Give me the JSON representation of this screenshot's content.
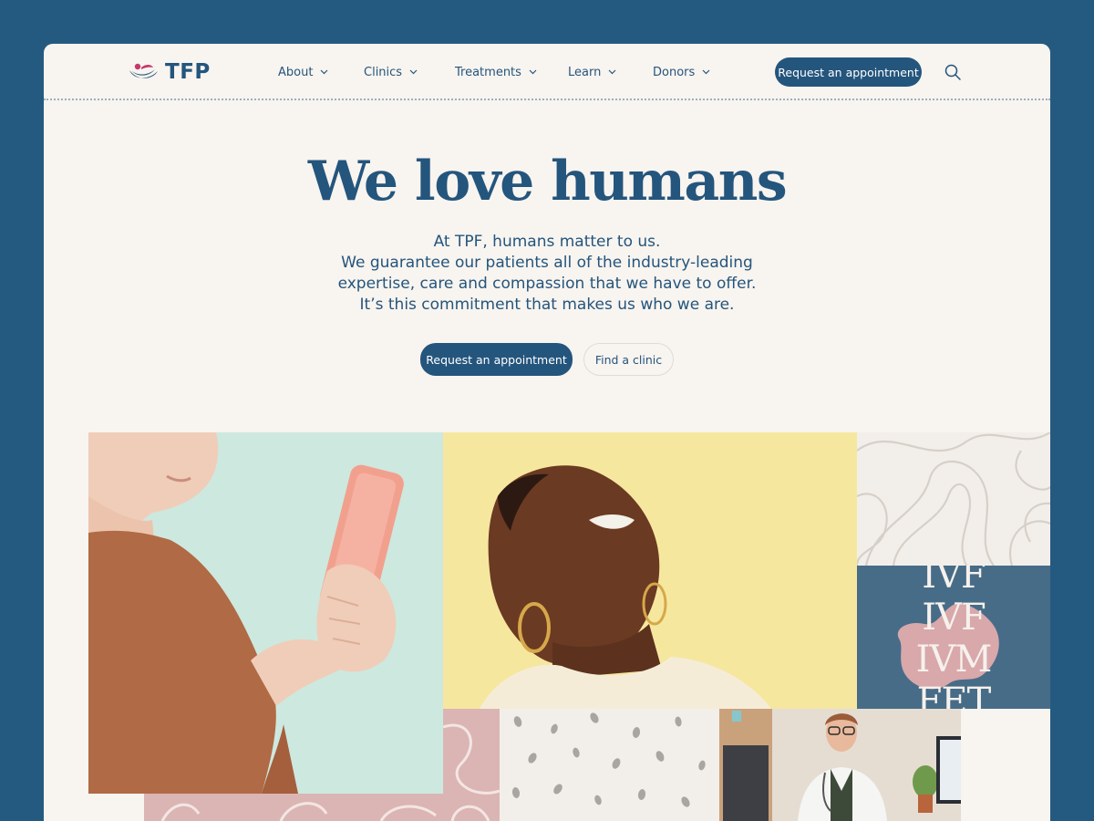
{
  "brand": {
    "name": "TFP"
  },
  "nav": {
    "items": [
      {
        "label": "About"
      },
      {
        "label": "Clinics"
      },
      {
        "label": "Treatments"
      },
      {
        "label": "Learn"
      },
      {
        "label": "Donors"
      }
    ],
    "cta_label": "Request an appointment",
    "search_icon": "search-icon"
  },
  "hero": {
    "title": "We love humans",
    "lines": [
      "At TPF, humans matter to us.",
      "We guarantee our patients all of the industry-leading",
      "expertise, care and compassion that we have to offer.",
      "It’s this commitment that makes us who we are."
    ],
    "primary_cta": "Request an appointment",
    "secondary_cta": "Find a clinic"
  },
  "collage": {
    "ivf_words": [
      "IVF",
      "IVF",
      "IVM",
      "FET"
    ]
  },
  "colors": {
    "background": "#255a80",
    "page": "#f8f4ef",
    "brand_blue": "#24557d",
    "brand_pink": "#c23a6b",
    "mint": "#cde8df",
    "yellow": "#f6e79f",
    "blush": "#dbb5b3",
    "slate": "#476c88"
  }
}
